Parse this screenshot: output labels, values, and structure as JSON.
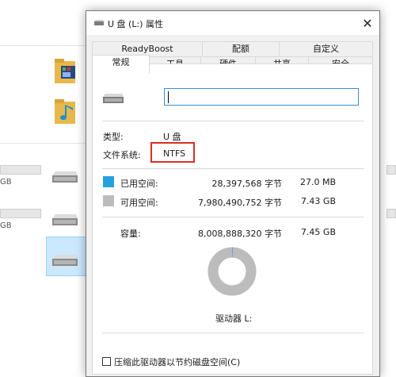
{
  "dialog": {
    "title": "U 盘 (L:) 属性",
    "close_glyph": "✕",
    "tabs_row1": [
      "ReadyBoost",
      "配额",
      "自定义"
    ],
    "tabs_row2": [
      "常规",
      "工具",
      "硬件",
      "共享",
      "安全"
    ],
    "active_tab": "常规"
  },
  "general": {
    "name_value": "",
    "type_label": "类型:",
    "type_value": "U 盘",
    "fs_label": "文件系统:",
    "fs_value": "NTFS",
    "used_label": "已用空间:",
    "used_bytes": "28,397,568 字节",
    "used_size": "27.0 MB",
    "free_label": "可用空间:",
    "free_bytes": "7,980,490,752 字节",
    "free_size": "7.43 GB",
    "capacity_label": "容量:",
    "capacity_bytes": "8,008,888,320 字节",
    "capacity_size": "7.45 GB",
    "drive_label": "驱动器 L:",
    "compress_label": "压缩此驱动器以节约磁盘空间(C)",
    "used_fraction": 0.0035
  },
  "background": {
    "gb_labels": [
      "GB",
      "GB"
    ]
  },
  "colors": {
    "used": "#26a0da",
    "free": "#bcbcbc",
    "highlight": "#d93025"
  },
  "icons": [
    "usb-drive-icon",
    "folder-video-icon",
    "folder-music-icon",
    "close-icon",
    "checkbox-icon"
  ]
}
